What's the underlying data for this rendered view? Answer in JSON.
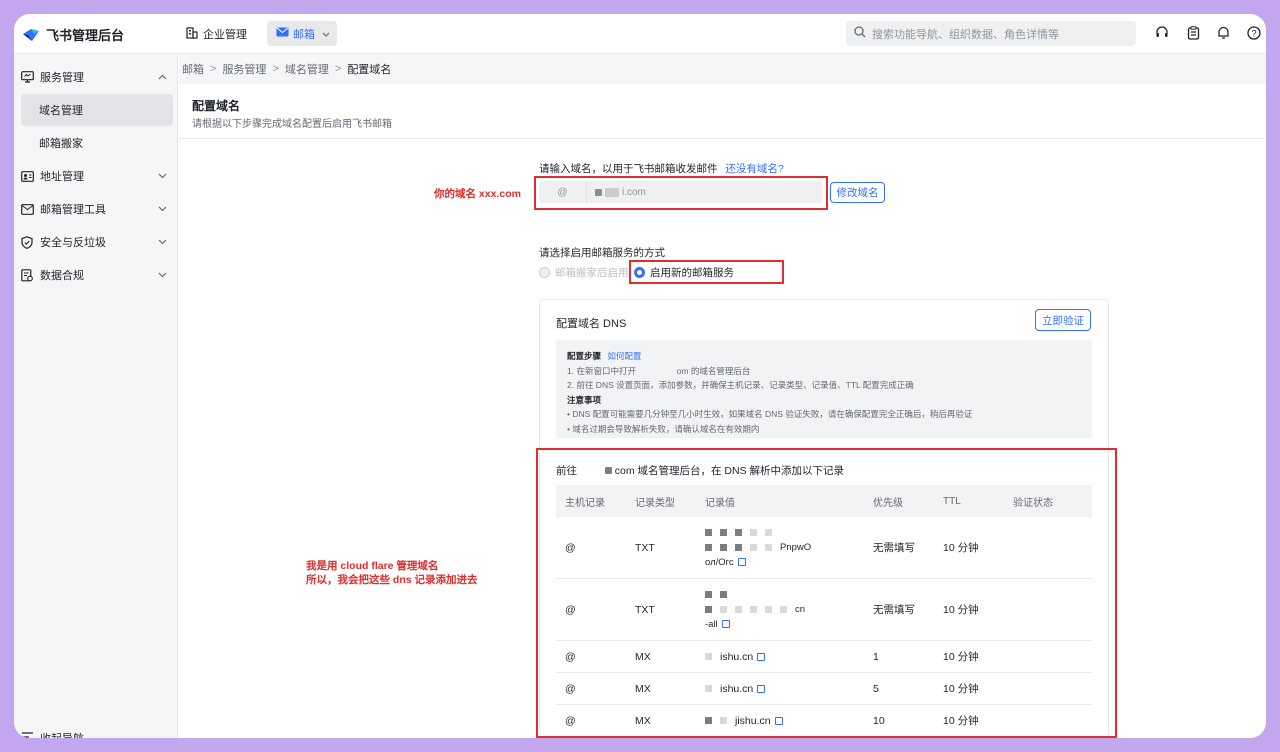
{
  "app": {
    "title": "飞书管理后台"
  },
  "topnav": {
    "company": "企业管理",
    "mail": "邮箱"
  },
  "search": {
    "placeholder": "搜索功能导航、组织数据、角色详情等"
  },
  "sidebar": {
    "items": [
      {
        "label": "服务管理",
        "icon": "monitor-icon",
        "expanded": true
      },
      {
        "label": "地址管理",
        "icon": "contact-card-icon"
      },
      {
        "label": "邮箱管理工具",
        "icon": "mail-tool-icon"
      },
      {
        "label": "安全与反垃圾",
        "icon": "shield-icon"
      },
      {
        "label": "数据合规",
        "icon": "data-doc-icon"
      }
    ],
    "subitems": [
      {
        "label": "域名管理",
        "active": true
      },
      {
        "label": "邮箱搬家"
      }
    ],
    "collapse": "收起导航"
  },
  "breadcrumb": [
    "邮箱",
    "服务管理",
    "域名管理",
    "配置域名"
  ],
  "page": {
    "title": "配置域名",
    "subtitle": "请根据以下步骤完成域名配置后启用飞书邮箱"
  },
  "domain": {
    "prompt": "请输入域名，以用于飞书邮箱收发邮件",
    "no_domain_link": "还没有域名?",
    "at": "@",
    "value_suffix": "i.com",
    "edit_button": "修改域名"
  },
  "annotations": {
    "domain_note": "你的域名 xxx.com",
    "dns_note_line1": "我是用 cloud flare 管理域名",
    "dns_note_line2": "所以，我会把这些 dns 记录添加进去"
  },
  "service": {
    "prompt": "请选择启用邮箱服务的方式",
    "option_migrate": "邮箱搬家后启用",
    "option_new": "启用新的邮箱服务",
    "selected": "option_new"
  },
  "dns": {
    "title": "配置域名 DNS",
    "verify_button": "立即验证",
    "steps_title": "配置步骤",
    "how_link": "如何配置",
    "step1_prefix": "1. 在新窗口中打开",
    "step1_suffix": "om 的域名管理后台",
    "step2": "2. 前往 DNS 设置页面，添加参数，并确保主机记录、记录类型、记录值、TTL 配置完成正确",
    "notes_title": "注意事项",
    "note1": "DNS 配置可能需要几分钟至几小时生效，如果域名 DNS 验证失败，请在确保配置完全正确后，稍后再验证",
    "note2": "域名过期会导致解析失败，请确认域名在有效期内",
    "intro_prefix": "前往",
    "intro_suffix": "com 域名管理后台，在 DNS 解析中添加以下记录",
    "headers": [
      "主机记录",
      "记录类型",
      "记录值",
      "优先级",
      "TTL",
      "验证状态"
    ],
    "rows": [
      {
        "host": "@",
        "type": "TXT",
        "value_a": "PnpwO",
        "value_b": "ол/Огс",
        "priority": "无需填写",
        "ttl": "10 分钟",
        "status": ""
      },
      {
        "host": "@",
        "type": "TXT",
        "value_a": "cn",
        "value_b": "-all",
        "priority": "无需填写",
        "ttl": "10 分钟",
        "status": ""
      },
      {
        "host": "@",
        "type": "MX",
        "value": "ishu.cn",
        "priority": "1",
        "ttl": "10 分钟",
        "status": ""
      },
      {
        "host": "@",
        "type": "MX",
        "value": "ishu.cn",
        "priority": "5",
        "ttl": "10 分钟",
        "status": ""
      },
      {
        "host": "@",
        "type": "MX",
        "value": "jishu.cn",
        "priority": "10",
        "ttl": "10 分钟",
        "status": ""
      }
    ]
  },
  "colors": {
    "accent": "#3370ff",
    "annotation": "#e02d2d",
    "frame": "#c3a7ee"
  }
}
